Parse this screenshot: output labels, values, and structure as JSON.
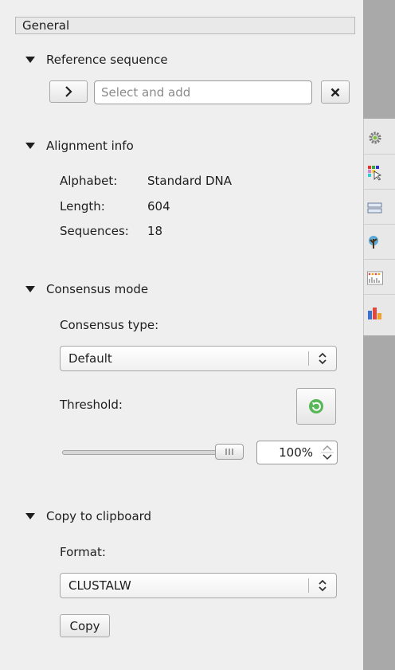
{
  "header": {
    "title": "General"
  },
  "reference": {
    "title": "Reference sequence",
    "placeholder": "Select and add"
  },
  "alignment": {
    "title": "Alignment info",
    "rows": [
      {
        "label": "Alphabet:",
        "value": "Standard DNA"
      },
      {
        "label": "Length:",
        "value": "604"
      },
      {
        "label": "Sequences:",
        "value": "18"
      }
    ]
  },
  "consensus": {
    "title": "Consensus mode",
    "type_label": "Consensus type:",
    "type_value": "Default",
    "threshold_label": "Threshold:",
    "threshold_value": "100%",
    "threshold_percent": 100
  },
  "clipboard": {
    "title": "Copy to clipboard",
    "format_label": "Format:",
    "format_value": "CLUSTALW",
    "copy_label": "Copy"
  },
  "side_tabs": [
    {
      "icon": "gear-icon"
    },
    {
      "icon": "highlighting-icon"
    },
    {
      "icon": "tree-settings-icon"
    },
    {
      "icon": "tree-icon"
    },
    {
      "icon": "statistics-icon"
    },
    {
      "icon": "bar-chart-icon"
    }
  ],
  "colors": {
    "accent_green": "#3aa33a",
    "strip": "#a9a9a9",
    "panel": "#efefef"
  }
}
